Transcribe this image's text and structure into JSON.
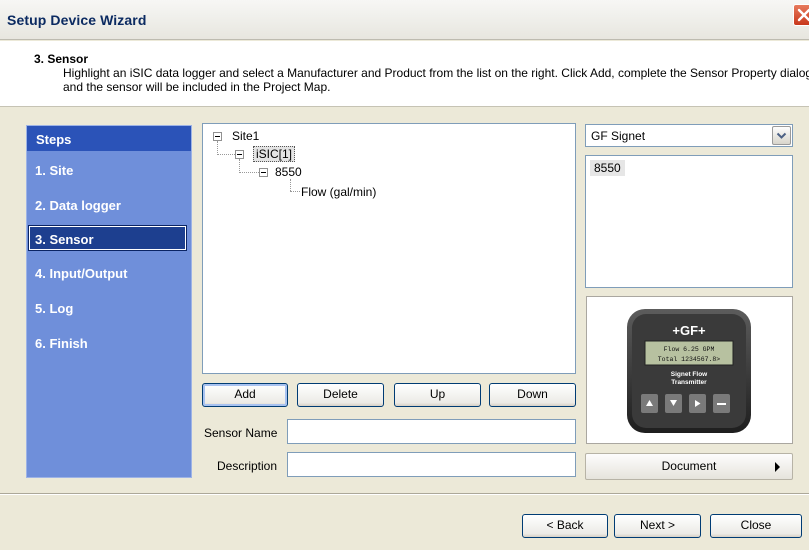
{
  "window": {
    "title": "Setup Device Wizard"
  },
  "header": {
    "step_title": "3. Sensor",
    "description": "Highlight an iSIC data logger and select a Manufacturer and Product from the list on the right. Click Add, complete the Sensor Property dialog and the sensor will be included in the Project Map."
  },
  "steps": {
    "heading": "Steps",
    "items": [
      "1. Site",
      "2. Data logger",
      "3. Sensor",
      "4. Input/Output",
      "5. Log",
      "6. Finish"
    ],
    "active_index": 2
  },
  "tree": {
    "site": "Site1",
    "logger": "iSIC[1]",
    "sensor": "8550",
    "channel": "Flow (gal/min)"
  },
  "tree_buttons": {
    "add": "Add",
    "delete": "Delete",
    "up": "Up",
    "down": "Down"
  },
  "form": {
    "sensor_name_label": "Sensor Name",
    "sensor_name_value": "",
    "description_label": "Description",
    "description_value": ""
  },
  "manufacturer": {
    "selected": "GF Signet"
  },
  "products": [
    "8550"
  ],
  "device_image": {
    "brand": "+GF+",
    "line1": "Flow 6.25 GPM",
    "line2": "Total 1234567.8>",
    "label1": "Signet Flow",
    "label2": "Transmitter"
  },
  "document_button": "Document",
  "nav": {
    "back": "< Back",
    "next": "Next >",
    "close": "Close"
  },
  "colors": {
    "steps_bg": "#6f8fda",
    "steps_head": "#2b53b8",
    "active_step": "#1d3f8f",
    "title_text": "#0b2a61"
  }
}
